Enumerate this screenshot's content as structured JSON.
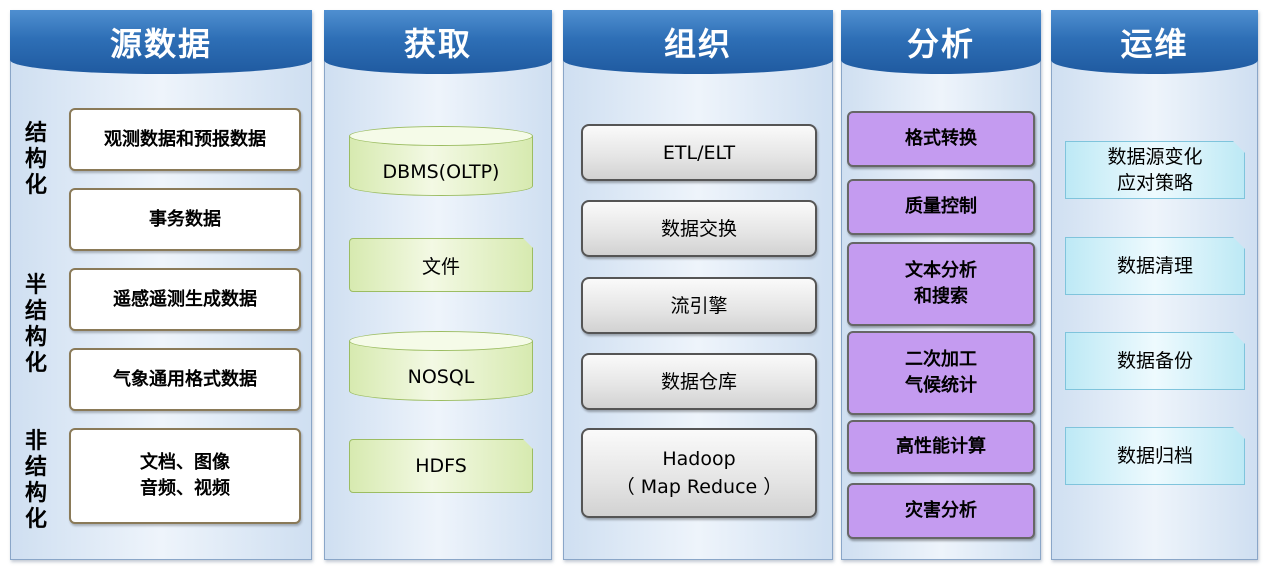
{
  "columns": {
    "source": {
      "title": "源数据",
      "groups": [
        "结构化",
        "半结构化",
        "非结构化"
      ],
      "items": [
        "观测数据和预报数据",
        "事务数据",
        "遥感遥测生成数据",
        "气象通用格式数据",
        "文档、图像\n音频、视频"
      ]
    },
    "acquire": {
      "title": "获取",
      "items": [
        "DBMS(OLTP)",
        "文件",
        "NOSQL",
        "HDFS"
      ]
    },
    "organize": {
      "title": "组织",
      "items": [
        "ETL/ELT",
        "数据交换",
        "流引擎",
        "数据仓库",
        "Hadoop\n（ Map Reduce ）"
      ]
    },
    "analyze": {
      "title": "分析",
      "items": [
        "格式转换",
        "质量控制",
        "文本分析\n和搜索",
        "二次加工\n气候统计",
        "高性能计算",
        "灾害分析"
      ]
    },
    "operate": {
      "title": "运维",
      "items": [
        "数据源变化\n应对策略",
        "数据清理",
        "数据备份",
        "数据归档"
      ]
    }
  },
  "colors": {
    "header": "#2e6fb6",
    "analysis_box": "#c49bf0",
    "storage_box": "#d7eab0",
    "ops_box": "#bde9f5"
  }
}
